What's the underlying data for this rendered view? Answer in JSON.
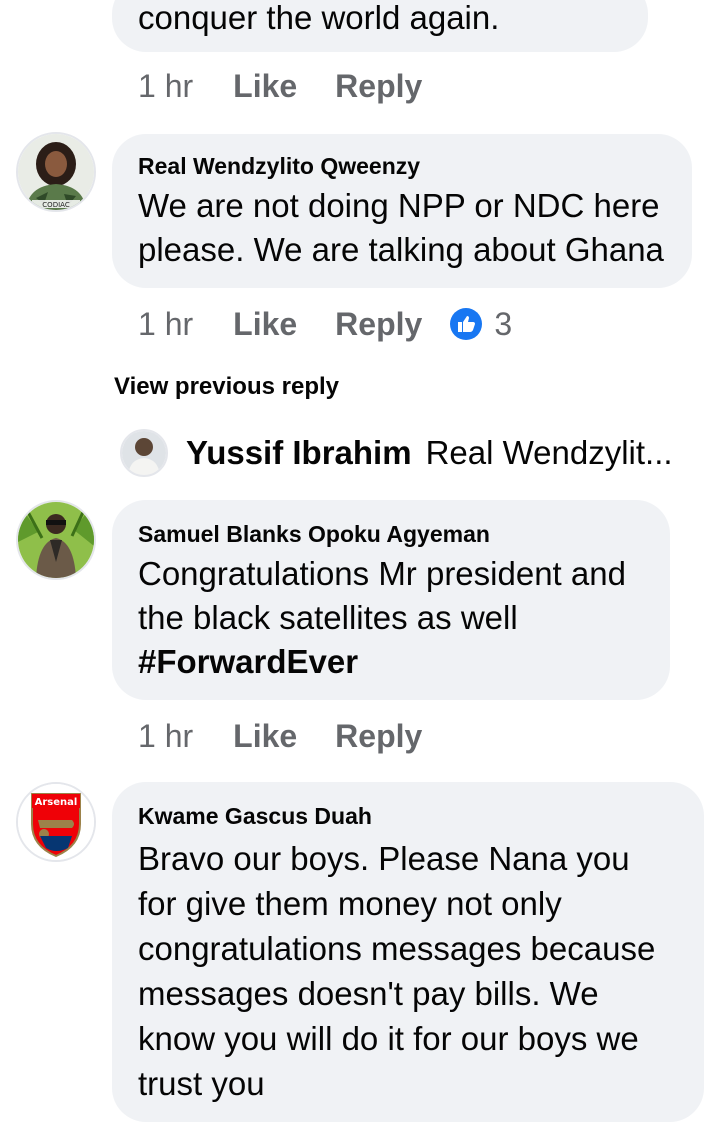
{
  "comments": [
    {
      "body": "conquer the world again.",
      "time": "1 hr",
      "like": "Like",
      "reply": "Reply"
    },
    {
      "author": "Real Wendzylito Qweenzy",
      "body": "We are not doing NPP or NDC here\nplease. We are talking about Ghana",
      "time": "1 hr",
      "like": "Like",
      "reply": "Reply",
      "reaction_icon": "thumbs-up-icon",
      "reaction_count": "3",
      "avatar_text": "CODIAC"
    },
    {
      "author": "Samuel Blanks Opoku Agyeman",
      "body": "Congratulations Mr president and\nthe black satellites as well",
      "hashtag": "#ForwardEver",
      "time": "1 hr",
      "like": "Like",
      "reply": "Reply"
    },
    {
      "author": "Kwame Gascus Duah",
      "body": "Bravo our boys.  Please Nana you\nfor give them money  not only\ncongratulations messages because\nmessages doesn't pay bills. We\nknow you will do it for our boys we\ntrust you",
      "avatar_text": "Arsenal"
    }
  ],
  "view_previous": "View previous reply",
  "reply_preview": {
    "author": "Yussif Ibrahim",
    "text": "Real Wendzylit..."
  },
  "colors": {
    "bubble": "#f0f2f5",
    "meta": "#65676b",
    "like_blue": "#1877f2"
  }
}
